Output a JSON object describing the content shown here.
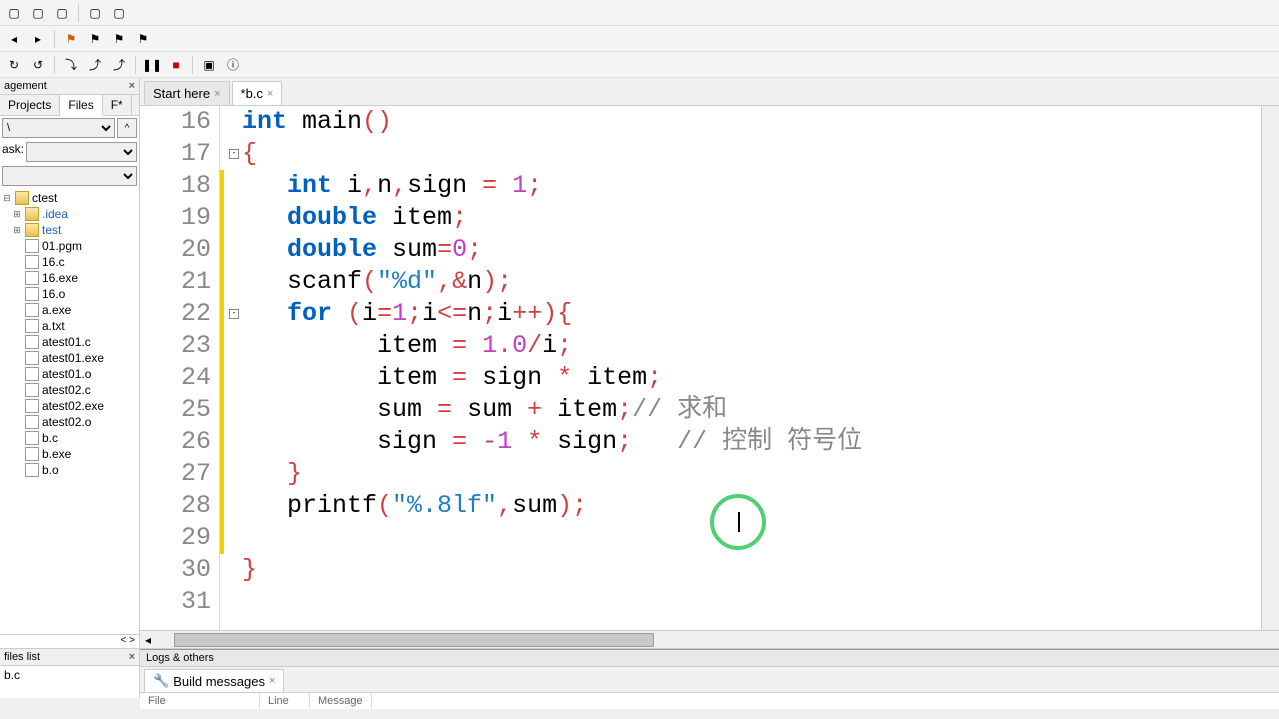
{
  "toolbarRows": 3,
  "leftPanel": {
    "headerLabel": "agement",
    "tabs": [
      "Projects",
      "Files",
      "F*"
    ],
    "activeTab": "Files",
    "pathValue": "\\",
    "askLabel": "ask:",
    "tree": [
      {
        "type": "folder",
        "name": "ctest",
        "expand": "-",
        "blue": false
      },
      {
        "type": "folder",
        "name": ".idea",
        "expand": "+",
        "blue": true,
        "indent": 1
      },
      {
        "type": "folder",
        "name": "test",
        "expand": "+",
        "blue": true,
        "indent": 1
      },
      {
        "type": "file",
        "name": "01.pgm",
        "indent": 1
      },
      {
        "type": "file",
        "name": "16.c",
        "indent": 1
      },
      {
        "type": "file",
        "name": "16.exe",
        "indent": 1
      },
      {
        "type": "file",
        "name": "16.o",
        "indent": 1
      },
      {
        "type": "file",
        "name": "a.exe",
        "indent": 1
      },
      {
        "type": "file",
        "name": "a.txt",
        "indent": 1
      },
      {
        "type": "file",
        "name": "atest01.c",
        "indent": 1
      },
      {
        "type": "file",
        "name": "atest01.exe",
        "indent": 1
      },
      {
        "type": "file",
        "name": "atest01.o",
        "indent": 1
      },
      {
        "type": "file",
        "name": "atest02.c",
        "indent": 1
      },
      {
        "type": "file",
        "name": "atest02.exe",
        "indent": 1
      },
      {
        "type": "file",
        "name": "atest02.o",
        "indent": 1
      },
      {
        "type": "file",
        "name": "b.c",
        "indent": 1
      },
      {
        "type": "file",
        "name": "b.exe",
        "indent": 1
      },
      {
        "type": "file",
        "name": "b.o",
        "indent": 1
      }
    ]
  },
  "filesList": {
    "header": "files list",
    "item": "b.c"
  },
  "editorTabs": [
    {
      "label": "Start here",
      "active": false
    },
    {
      "label": "*b.c",
      "active": true
    }
  ],
  "code": {
    "startLine": 16,
    "lines": [
      {
        "n": 16,
        "tokens": [
          {
            "t": "int ",
            "c": "kw"
          },
          {
            "t": "main",
            "c": ""
          },
          {
            "t": "()",
            "c": "op"
          }
        ]
      },
      {
        "n": 17,
        "fold": "-",
        "tokens": [
          {
            "t": "{",
            "c": "op"
          }
        ]
      },
      {
        "n": 18,
        "mark": true,
        "tokens": [
          {
            "t": "   ",
            "c": ""
          },
          {
            "t": "int ",
            "c": "kw"
          },
          {
            "t": "i",
            "c": ""
          },
          {
            "t": ",",
            "c": "op"
          },
          {
            "t": "n",
            "c": ""
          },
          {
            "t": ",",
            "c": "op"
          },
          {
            "t": "sign ",
            "c": ""
          },
          {
            "t": "= ",
            "c": "op"
          },
          {
            "t": "1",
            "c": "num"
          },
          {
            "t": ";",
            "c": "op"
          }
        ]
      },
      {
        "n": 19,
        "mark": true,
        "tokens": [
          {
            "t": "   ",
            "c": ""
          },
          {
            "t": "double ",
            "c": "kw"
          },
          {
            "t": "item",
            "c": ""
          },
          {
            "t": ";",
            "c": "op"
          }
        ]
      },
      {
        "n": 20,
        "mark": true,
        "tokens": [
          {
            "t": "   ",
            "c": ""
          },
          {
            "t": "double ",
            "c": "kw"
          },
          {
            "t": "sum",
            "c": ""
          },
          {
            "t": "=",
            "c": "op"
          },
          {
            "t": "0",
            "c": "num"
          },
          {
            "t": ";",
            "c": "op"
          }
        ]
      },
      {
        "n": 21,
        "mark": true,
        "tokens": [
          {
            "t": "   scanf",
            "c": ""
          },
          {
            "t": "(",
            "c": "op"
          },
          {
            "t": "\"%d\"",
            "c": "str"
          },
          {
            "t": ",&",
            "c": "op"
          },
          {
            "t": "n",
            "c": ""
          },
          {
            "t": ");",
            "c": "op"
          }
        ]
      },
      {
        "n": 22,
        "mark": true,
        "fold": "-",
        "tokens": [
          {
            "t": "   ",
            "c": ""
          },
          {
            "t": "for ",
            "c": "kw"
          },
          {
            "t": "(",
            "c": "op"
          },
          {
            "t": "i",
            "c": ""
          },
          {
            "t": "=",
            "c": "op"
          },
          {
            "t": "1",
            "c": "num"
          },
          {
            "t": ";",
            "c": "op"
          },
          {
            "t": "i",
            "c": ""
          },
          {
            "t": "<=",
            "c": "op"
          },
          {
            "t": "n",
            "c": ""
          },
          {
            "t": ";",
            "c": "op"
          },
          {
            "t": "i",
            "c": ""
          },
          {
            "t": "++){",
            "c": "op"
          }
        ]
      },
      {
        "n": 23,
        "mark": true,
        "tokens": [
          {
            "t": "         item ",
            "c": ""
          },
          {
            "t": "= ",
            "c": "op"
          },
          {
            "t": "1.0",
            "c": "num"
          },
          {
            "t": "/",
            "c": "op"
          },
          {
            "t": "i",
            "c": ""
          },
          {
            "t": ";",
            "c": "op"
          }
        ]
      },
      {
        "n": 24,
        "mark": true,
        "tokens": [
          {
            "t": "         item ",
            "c": ""
          },
          {
            "t": "= ",
            "c": "op"
          },
          {
            "t": "sign ",
            "c": ""
          },
          {
            "t": "* ",
            "c": "op"
          },
          {
            "t": "item",
            "c": ""
          },
          {
            "t": ";",
            "c": "op"
          }
        ]
      },
      {
        "n": 25,
        "mark": true,
        "tokens": [
          {
            "t": "         sum ",
            "c": ""
          },
          {
            "t": "= ",
            "c": "op"
          },
          {
            "t": "sum ",
            "c": ""
          },
          {
            "t": "+ ",
            "c": "op"
          },
          {
            "t": "item",
            "c": ""
          },
          {
            "t": ";",
            "c": "op"
          },
          {
            "t": "// 求和",
            "c": "cmt"
          }
        ]
      },
      {
        "n": 26,
        "mark": true,
        "tokens": [
          {
            "t": "         sign ",
            "c": ""
          },
          {
            "t": "= ",
            "c": "op"
          },
          {
            "t": "-",
            "c": "op"
          },
          {
            "t": "1",
            "c": "num"
          },
          {
            "t": " * ",
            "c": "op"
          },
          {
            "t": "sign",
            "c": ""
          },
          {
            "t": ";   ",
            "c": "op"
          },
          {
            "t": "// 控制 符号位",
            "c": "cmt"
          }
        ]
      },
      {
        "n": 27,
        "mark": true,
        "tokens": [
          {
            "t": "   ",
            "c": ""
          },
          {
            "t": "}",
            "c": "op"
          }
        ]
      },
      {
        "n": 28,
        "mark": true,
        "tokens": [
          {
            "t": "   printf",
            "c": ""
          },
          {
            "t": "(",
            "c": "op"
          },
          {
            "t": "\"%.8lf\"",
            "c": "str"
          },
          {
            "t": ",",
            "c": "op"
          },
          {
            "t": "sum",
            "c": ""
          },
          {
            "t": ");",
            "c": "op"
          }
        ]
      },
      {
        "n": 29,
        "mark": true,
        "tokens": []
      },
      {
        "n": 30,
        "tokens": [
          {
            "t": "}",
            "c": "op"
          }
        ]
      },
      {
        "n": 31,
        "tokens": []
      }
    ]
  },
  "bottom": {
    "logsLabel": "Logs & others",
    "buildTab": "Build messages",
    "cols": [
      "File",
      "Line",
      "Message"
    ]
  }
}
